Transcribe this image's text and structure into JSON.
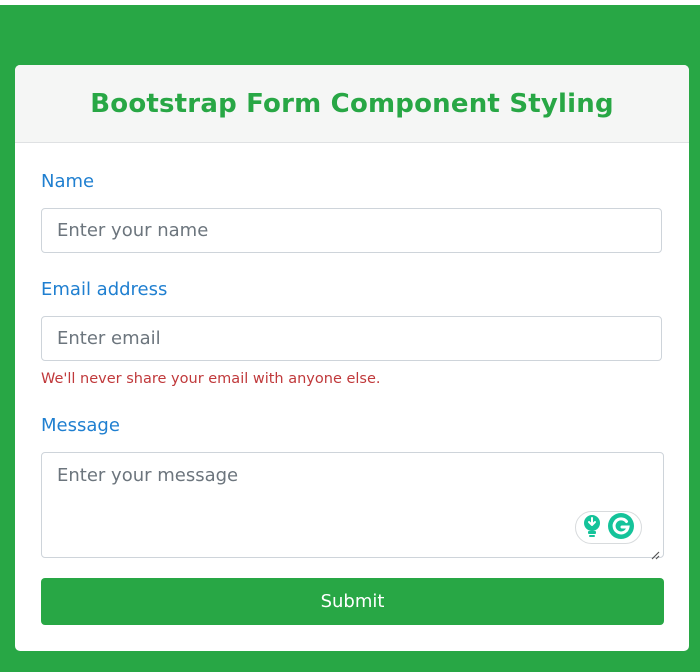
{
  "form": {
    "title": "Bootstrap Form Component Styling",
    "name_label": "Name",
    "name_placeholder": "Enter your name",
    "email_label": "Email address",
    "email_placeholder": "Enter email",
    "email_help": "We'll never share your email with anyone else.",
    "message_label": "Message",
    "message_placeholder": "Enter your message",
    "submit_label": "Submit"
  },
  "icons": {
    "grammarly_suggestion": "lightbulb-icon",
    "grammarly_logo": "grammarly-icon",
    "resize": "resize-handle-icon"
  },
  "colors": {
    "brand_green": "#28a745",
    "label_blue": "#1f7fd0",
    "help_red": "#c0393b",
    "grammarly_teal": "#15c39a"
  }
}
